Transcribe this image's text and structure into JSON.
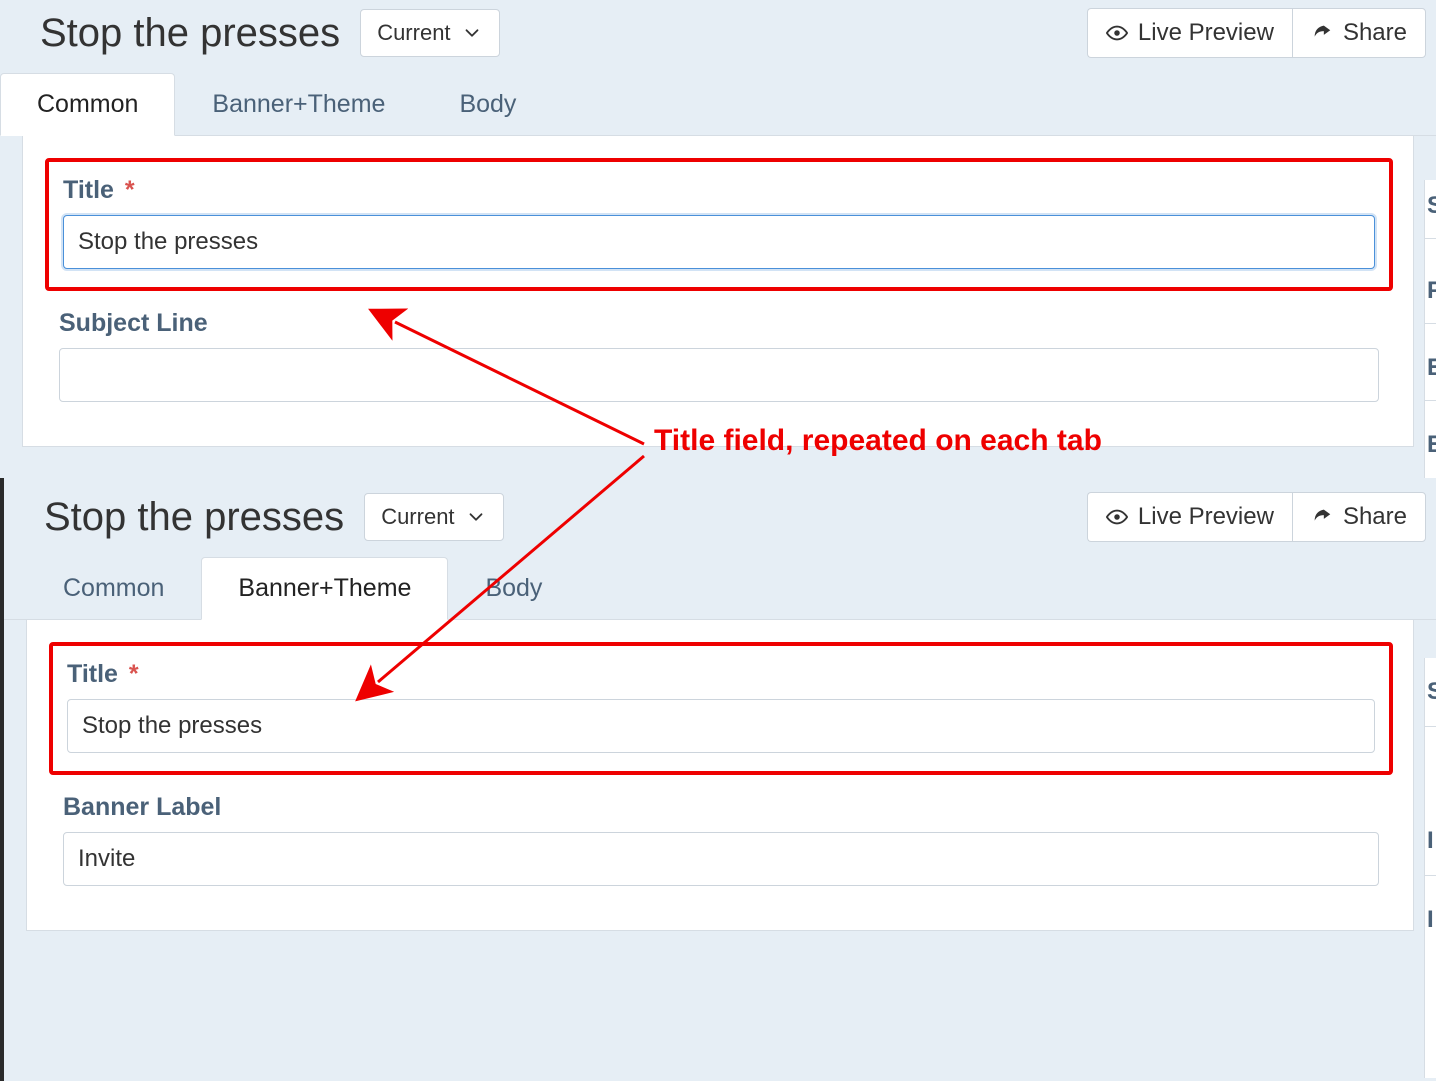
{
  "annotation": {
    "text": "Title field, repeated on each tab"
  },
  "panes": {
    "top": {
      "title": "Stop the presses",
      "dropdown": "Current",
      "actions": {
        "preview": "Live Preview",
        "share": "Share"
      },
      "tabs": {
        "common": "Common",
        "banner": "Banner+Theme",
        "body": "Body",
        "active": "common"
      },
      "form": {
        "title_label": "Title",
        "title_value": "Stop the presses",
        "subject_label": "Subject Line",
        "subject_value": ""
      },
      "sidebar_letters": [
        "S",
        "F",
        "E",
        "E"
      ]
    },
    "bottom": {
      "title": "Stop the presses",
      "dropdown": "Current",
      "actions": {
        "preview": "Live Preview",
        "share": "Share"
      },
      "tabs": {
        "common": "Common",
        "banner": "Banner+Theme",
        "body": "Body",
        "active": "banner"
      },
      "form": {
        "title_label": "Title",
        "title_value": "Stop the presses",
        "banner_label": "Banner Label",
        "banner_value": "Invite"
      },
      "sidebar_letters": [
        "S",
        "I",
        "I"
      ]
    }
  }
}
